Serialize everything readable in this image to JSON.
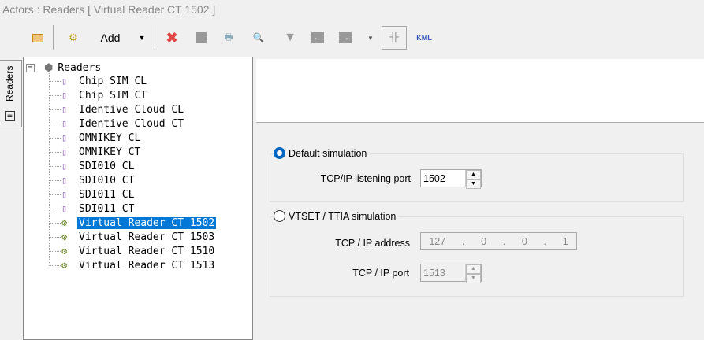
{
  "title": "Actors : Readers [ Virtual Reader CT 1502 ]",
  "toolbar": {
    "add_label": "Add",
    "kml_label": "KML"
  },
  "side_tab": {
    "label": "Readers"
  },
  "tree": {
    "root": "Readers",
    "items": [
      "Chip SIM CL",
      "Chip SIM CT",
      "Identive Cloud CL",
      "Identive Cloud CT",
      "OMNIKEY CL",
      "OMNIKEY CT",
      "SDI010  CL",
      "SDI010 CT",
      "SDI011 CL",
      "SDI011 CT",
      "Virtual Reader CT 1502",
      "Virtual Reader CT 1503",
      "Virtual Reader CT 1510",
      "Virtual Reader CT 1513"
    ],
    "selected": "Virtual Reader CT 1502"
  },
  "form": {
    "default_sim": {
      "label": "Default simulation",
      "selected": true,
      "port_label": "TCP/IP listening port",
      "port_value": "1502"
    },
    "vtset_sim": {
      "label": "VTSET / TTIA simulation",
      "selected": false,
      "ip_label": "TCP / IP address",
      "ip": [
        "127",
        "0",
        "0",
        "1"
      ],
      "port_label": "TCP / IP port",
      "port_value": "1513"
    }
  }
}
